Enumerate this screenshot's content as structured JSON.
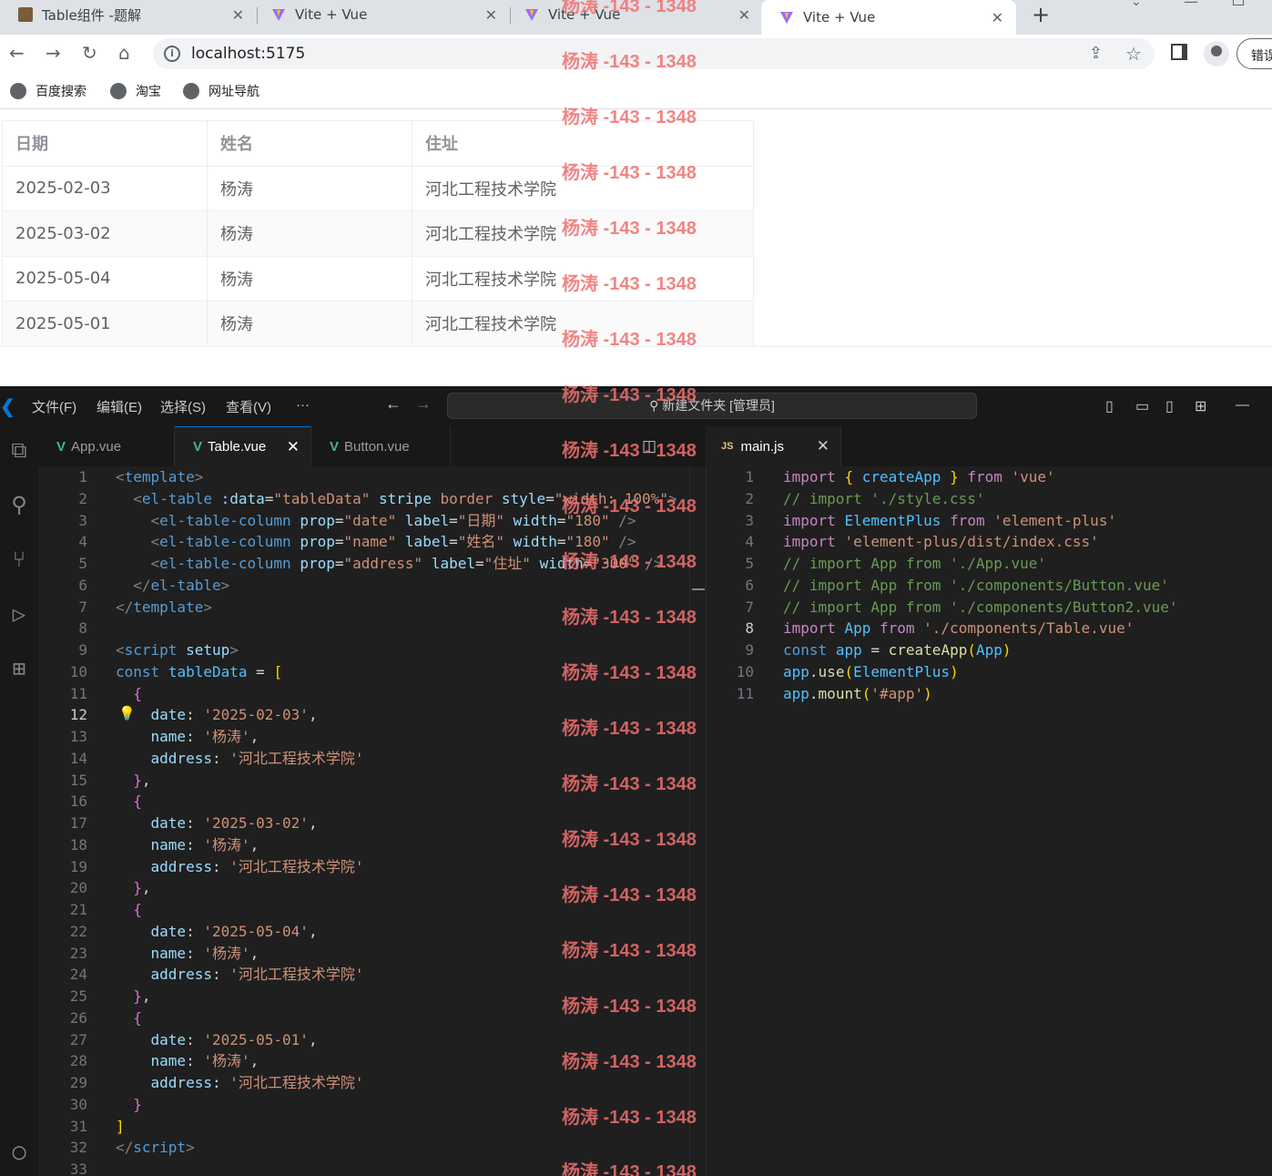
{
  "browser": {
    "tabs": [
      {
        "title": "Table组件 -题解"
      },
      {
        "title": "Vite + Vue"
      },
      {
        "title": "Vite + Vue"
      },
      {
        "title": "Vite + Vue"
      }
    ],
    "url": "localhost:5175",
    "bookmarks": [
      "百度搜索",
      "淘宝",
      "网址导航"
    ],
    "error_button": "错误"
  },
  "table": {
    "headers": [
      "日期",
      "姓名",
      "住址"
    ],
    "rows": [
      [
        "2025-02-03",
        "杨涛",
        "河北工程技术学院"
      ],
      [
        "2025-03-02",
        "杨涛",
        "河北工程技术学院"
      ],
      [
        "2025-05-04",
        "杨涛",
        "河北工程技术学院"
      ],
      [
        "2025-05-01",
        "杨涛",
        "河北工程技术学院"
      ]
    ]
  },
  "vscode": {
    "menu": [
      "文件(F)",
      "编辑(E)",
      "选择(S)",
      "查看(V)",
      "···"
    ],
    "command_center": "新建文件夹 [管理员]",
    "left_tabs": [
      "App.vue",
      "Table.vue",
      "Button.vue"
    ],
    "right_tab": "main.js",
    "left_current_line": 12,
    "right_current_line": 8
  },
  "watermark": "杨涛 -143 - 1348"
}
